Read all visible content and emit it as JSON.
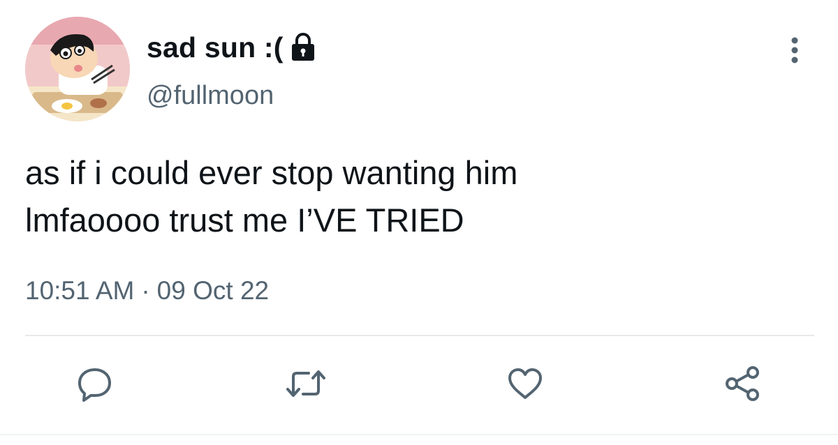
{
  "user": {
    "display_name": "sad sun :(",
    "handle": "@fullmoon",
    "protected": true,
    "avatar_description": "cartoon-avatar"
  },
  "tweet": {
    "lines": [
      "as if i could ever stop wanting him",
      "lmfaoooo trust me I’VE TRIED"
    ],
    "time": "10:51 AM",
    "separator": "·",
    "date": "09 Oct 22"
  },
  "actions": {
    "reply_icon": "reply-icon",
    "retweet_icon": "retweet-icon",
    "like_icon": "heart-icon",
    "share_icon": "share-icon"
  },
  "colors": {
    "text_primary": "#0f1419",
    "text_secondary": "#536471",
    "divider": "#e7e9ea"
  }
}
